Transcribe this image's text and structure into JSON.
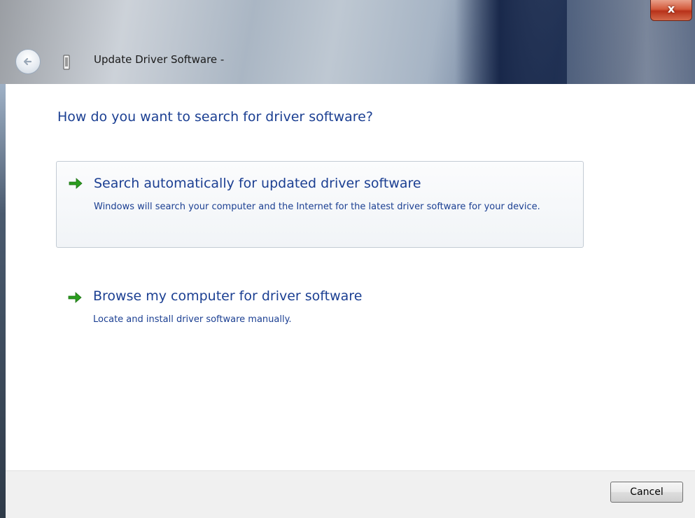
{
  "window": {
    "title": "Update Driver Software -",
    "close_label": "x",
    "icons": {
      "back": "back-arrow-icon",
      "device": "device-icon",
      "close": "close-icon",
      "option_arrow": "green-arrow-icon"
    }
  },
  "content": {
    "heading": "How do you want to search for driver software?",
    "options": [
      {
        "title": "Search automatically for updated driver software",
        "description": "Windows will search your computer and the Internet for the latest driver software for your device."
      },
      {
        "title": "Browse my computer for driver software",
        "description": "Locate and install driver software manually."
      }
    ]
  },
  "footer": {
    "cancel_label": "Cancel"
  },
  "colors": {
    "link_text": "#1b3f92",
    "arrow_green": "#2a9d1e",
    "footer_bg": "#f0f0f0",
    "close_red": "#c8452a"
  }
}
